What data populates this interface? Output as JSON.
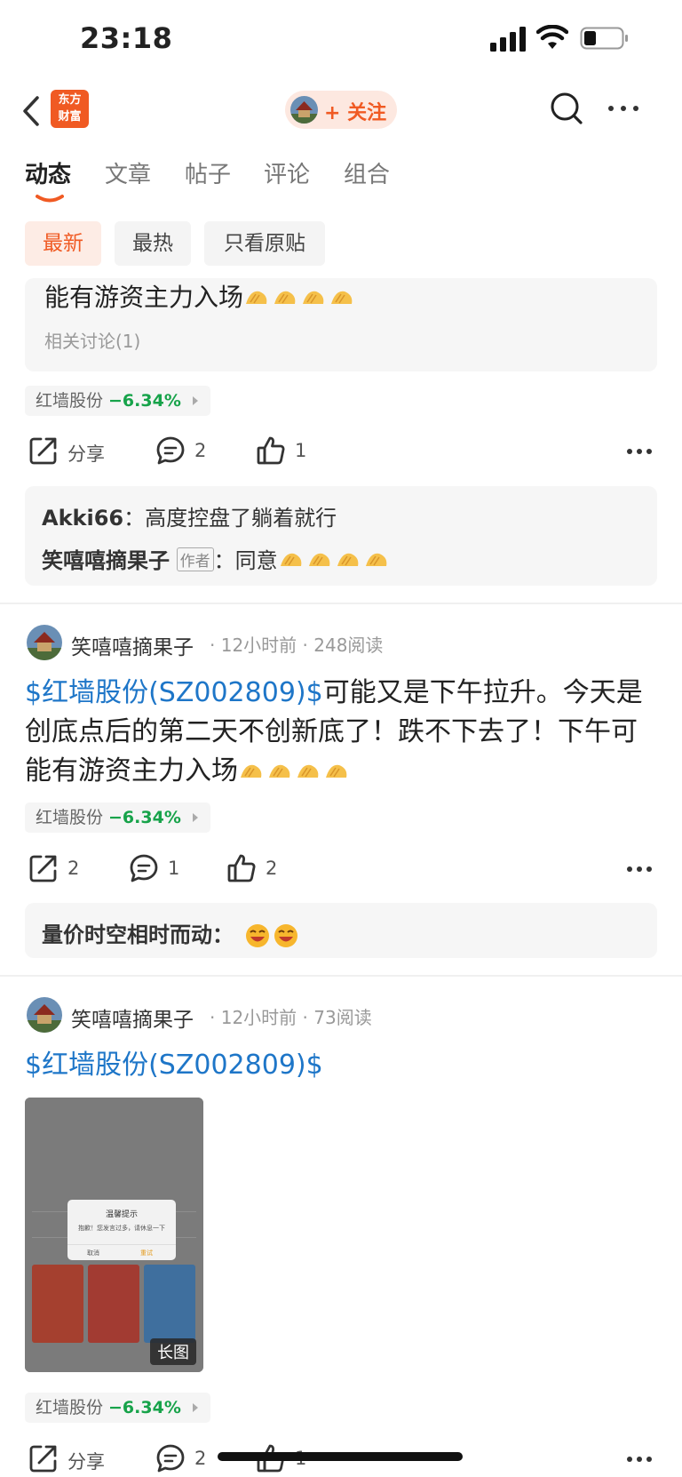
{
  "status_bar": {
    "time": "23:18"
  },
  "nav": {
    "logo_line1": "东方",
    "logo_line2": "财富",
    "follow_label": "+ 关注"
  },
  "tabs": [
    "动态",
    "文章",
    "帖子",
    "评论",
    "组合"
  ],
  "filters": [
    "最新",
    "最热",
    "只看原贴"
  ],
  "post1": {
    "text_tail": "能有游资主力入场",
    "related": "相关讨论(1)",
    "stock_name": "红墙股份",
    "stock_change": "−6.34%",
    "share_label": "分享",
    "comment_count": "2",
    "like_count": "1",
    "comments": [
      {
        "author": "Akki66",
        "sep": "：",
        "text": "高度控盘了躺着就行"
      },
      {
        "author": "笑嘻嘻摘果子",
        "badge": "作者",
        "sep": "：",
        "text": "同意"
      }
    ]
  },
  "post2": {
    "author": "笑嘻嘻摘果子",
    "time": "12小时前",
    "reads": "248阅读",
    "stock_link": "$红墙股份(SZ002809)$",
    "text": "可能又是下午拉升。今天是创底点后的第二天不创新底了！跌不下去了！下午可能有游资主力入场",
    "stock_name": "红墙股份",
    "stock_change": "−6.34%",
    "share_count": "2",
    "comment_count": "1",
    "like_count": "2",
    "comment": {
      "author": "量价时空相时而动",
      "sep": "："
    }
  },
  "post3": {
    "author": "笑嘻嘻摘果子",
    "time": "12小时前",
    "reads": "73阅读",
    "stock_link": "$红墙股份(SZ002809)$",
    "image_badge": "长图",
    "dialog_title": "温馨提示",
    "dialog_text": "抱歉！您发言过多，请休息一下",
    "dialog_cancel": "取消",
    "dialog_retry": "重试",
    "stock_name": "红墙股份",
    "stock_change": "−6.34%",
    "share_label": "分享",
    "comment_count": "2",
    "like_count": "1"
  },
  "colors": {
    "accent": "#f05a23",
    "link": "#1e76c8",
    "down": "#17a34a"
  }
}
